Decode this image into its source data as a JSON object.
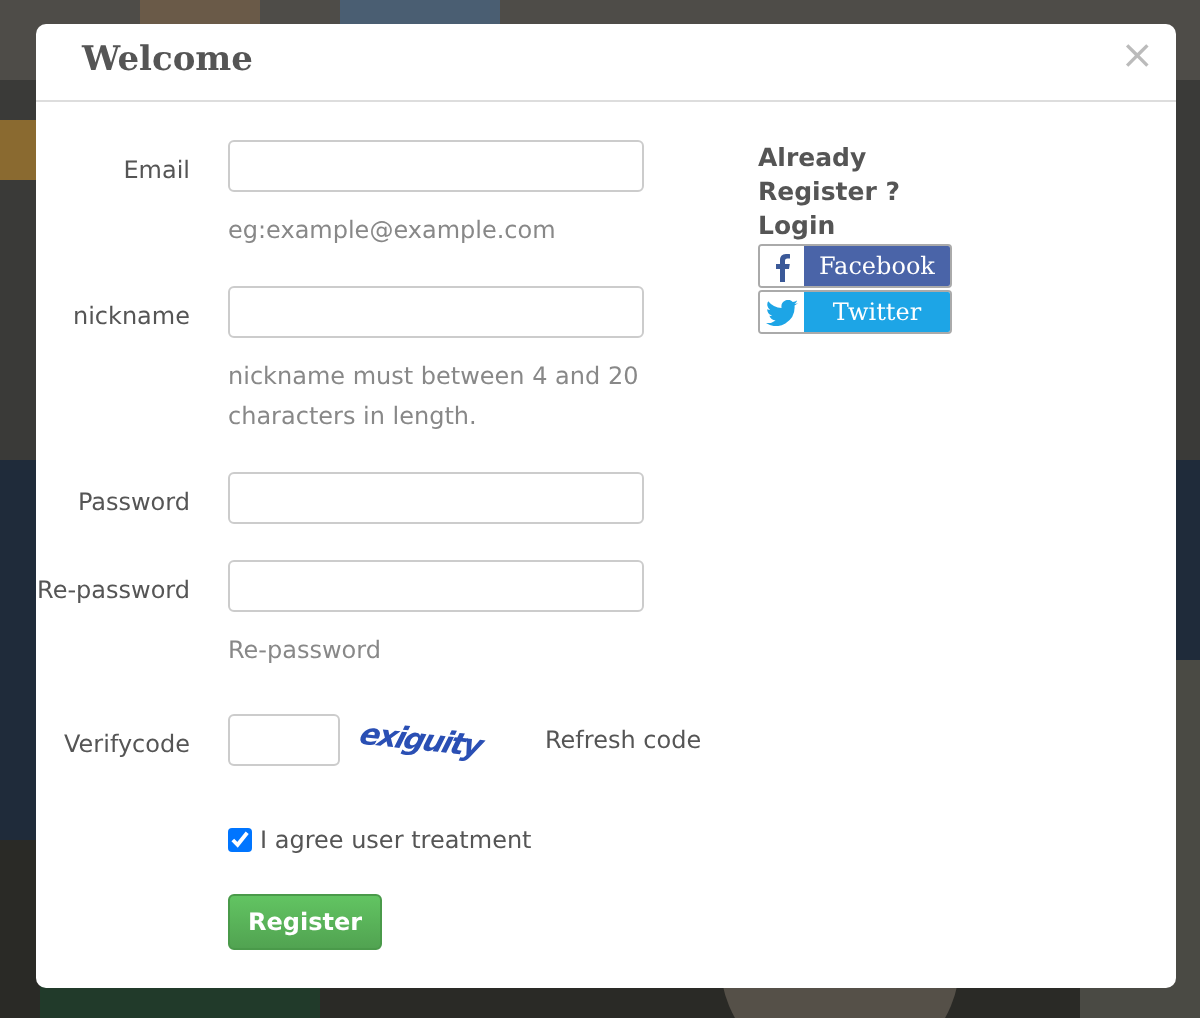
{
  "dialog": {
    "title": "Welcome",
    "close": "×"
  },
  "fields": [
    {
      "kind": "text",
      "label": "Email",
      "hint": "eg:example@example.com"
    },
    {
      "kind": "text",
      "label": "nickname",
      "hint": "nickname must between 4 and 20 characters in length."
    },
    {
      "kind": "text",
      "label": "Password"
    },
    {
      "kind": "text",
      "label": "Re-password",
      "hint": "Re-password"
    },
    {
      "kind": "verify",
      "label": "Verifycode",
      "captcha": "exiguity",
      "refresh": "Refresh code"
    }
  ],
  "agree": {
    "label": "I agree user treatment",
    "checked": true
  },
  "submit": "Register",
  "login": {
    "heading": "Already Register ? Login",
    "buttons": [
      {
        "kind": "facebook",
        "label": "Facebook"
      },
      {
        "kind": "twitter",
        "label": "Twitter"
      }
    ]
  }
}
